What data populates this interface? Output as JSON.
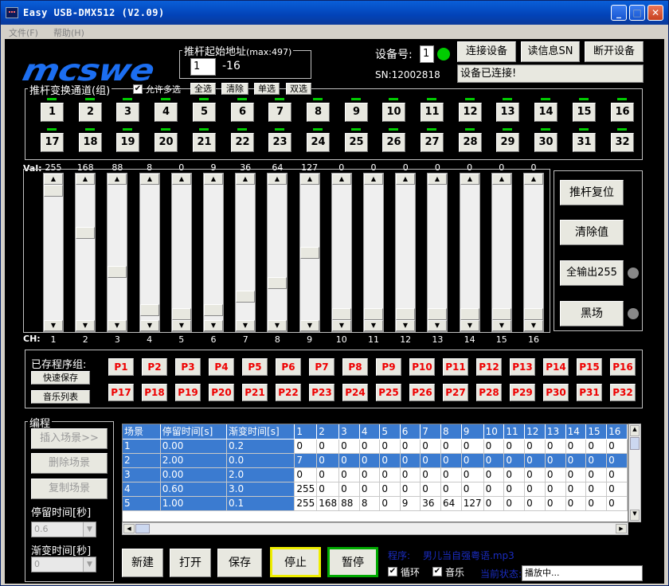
{
  "window": {
    "title": "Easy USB-DMX512  (V2.09)"
  },
  "menu": {
    "file": "文件(F)",
    "help": "帮助(H)"
  },
  "logo": "mcswe",
  "fader_start": {
    "label": "推杆起始地址",
    "max_hint": "(max:497)",
    "value": "1",
    "range_end": "-16"
  },
  "device": {
    "id_label": "设备号:",
    "id_value": "1",
    "connect": "连接设备",
    "read_sn": "读信息SN",
    "disconnect": "断开设备",
    "sn": "SN:12002818",
    "status": "设备已连接!",
    "status_color": "#00cc00"
  },
  "channel_group": {
    "label": "推杆变换通道(组)",
    "allow_multi": "允许多选",
    "allow_multi_checked": true,
    "select_all": "全选",
    "clear": "清除",
    "single": "单选",
    "double": "双选",
    "buttons": [
      "1",
      "2",
      "3",
      "4",
      "5",
      "6",
      "7",
      "8",
      "9",
      "10",
      "11",
      "12",
      "13",
      "14",
      "15",
      "16",
      "17",
      "18",
      "19",
      "20",
      "21",
      "22",
      "23",
      "24",
      "25",
      "26",
      "27",
      "28",
      "29",
      "30",
      "31",
      "32"
    ]
  },
  "faders": {
    "val_label": "Val:",
    "ch_label": "CH:",
    "values": [
      255,
      168,
      88,
      8,
      0,
      9,
      36,
      64,
      127,
      0,
      0,
      0,
      0,
      0,
      0,
      0
    ],
    "labels": [
      "1",
      "2",
      "3",
      "4",
      "5",
      "6",
      "7",
      "8",
      "9",
      "10",
      "11",
      "12",
      "13",
      "14",
      "15",
      "16"
    ],
    "reset": "推杆复位",
    "clear_values": "清除值",
    "all_out": "全输出255",
    "blackout": "黑场"
  },
  "programs": {
    "label": "已存程序组:",
    "quick_save": "快速保存",
    "music_list": "音乐列表",
    "buttons": [
      "P1",
      "P2",
      "P3",
      "P4",
      "P5",
      "P6",
      "P7",
      "P8",
      "P9",
      "P10",
      "P11",
      "P12",
      "P13",
      "P14",
      "P15",
      "P16",
      "P17",
      "P18",
      "P19",
      "P20",
      "P21",
      "P22",
      "P23",
      "P24",
      "P25",
      "P26",
      "P27",
      "P28",
      "P29",
      "P30",
      "P31",
      "P32"
    ]
  },
  "programming": {
    "label": "编程",
    "insert": "插入场景>>",
    "delete": "删除场景",
    "copy": "复制场景",
    "dwell_label": "停留时间[秒]",
    "dwell_value": "0.6",
    "fade_label": "渐变时间[秒]",
    "fade_value": "0"
  },
  "scene_table": {
    "columns": [
      "场景",
      "停留时间[s]",
      "渐变时间[s]",
      "1",
      "2",
      "3",
      "4",
      "5",
      "6",
      "7",
      "8",
      "9",
      "10",
      "11",
      "12",
      "13",
      "14",
      "15",
      "16"
    ],
    "rows": [
      [
        "1",
        "0.00",
        "0.2",
        "0",
        "0",
        "0",
        "0",
        "0",
        "0",
        "0",
        "0",
        "0",
        "0",
        "0",
        "0",
        "0",
        "0",
        "0",
        "0"
      ],
      [
        "2",
        "2.00",
        "0.0",
        "7",
        "0",
        "0",
        "0",
        "0",
        "0",
        "0",
        "0",
        "0",
        "0",
        "0",
        "0",
        "0",
        "0",
        "0",
        "0"
      ],
      [
        "3",
        "0.00",
        "2.0",
        "0",
        "0",
        "0",
        "0",
        "0",
        "0",
        "0",
        "0",
        "0",
        "0",
        "0",
        "0",
        "0",
        "0",
        "0",
        "0"
      ],
      [
        "4",
        "0.60",
        "3.0",
        "255",
        "0",
        "0",
        "0",
        "0",
        "0",
        "0",
        "0",
        "0",
        "0",
        "0",
        "0",
        "0",
        "0",
        "0",
        "0"
      ],
      [
        "5",
        "1.00",
        "0.1",
        "255",
        "168",
        "88",
        "8",
        "0",
        "9",
        "36",
        "64",
        "127",
        "0",
        "0",
        "0",
        "0",
        "0",
        "0",
        "0"
      ]
    ],
    "selected_row": 1
  },
  "bottom": {
    "new": "新建",
    "open": "打开",
    "save": "保存",
    "stop": "停止",
    "pause": "暂停",
    "program_label": "程序:",
    "music_file": "男儿当自强粤语.mp3",
    "loop": "循环",
    "loop_checked": true,
    "music": "音乐",
    "music_checked": true,
    "state_label": "当前状态:",
    "state_value": "播放中..."
  }
}
